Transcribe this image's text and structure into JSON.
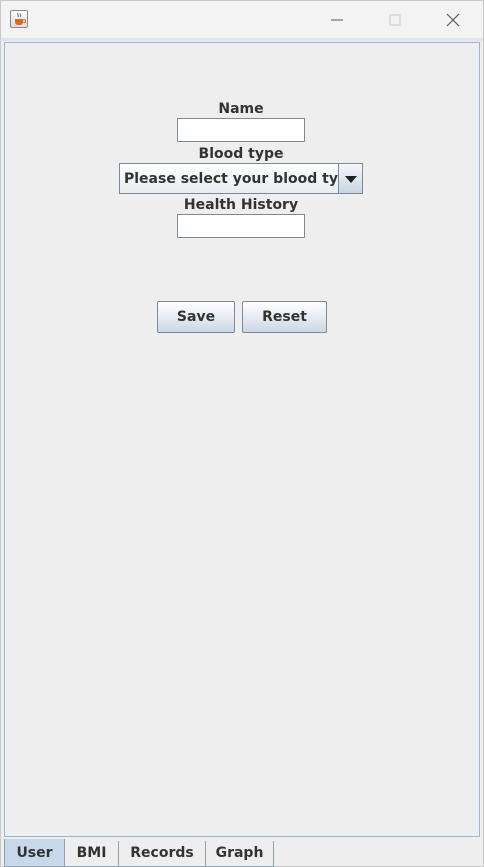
{
  "window": {
    "icon": "java-cup-icon",
    "controls": [
      "minimize-icon",
      "maximize-icon",
      "close-icon"
    ]
  },
  "form": {
    "name_label": "Name",
    "name_value": "",
    "blood_type_label": "Blood type",
    "blood_type_selected": "Please select your blood type",
    "health_history_label": "Health History",
    "health_history_value": ""
  },
  "buttons": {
    "save": "Save",
    "reset": "Reset"
  },
  "tabs": [
    {
      "label": "User",
      "active": true
    },
    {
      "label": "BMI",
      "active": false
    },
    {
      "label": "Records",
      "active": false
    },
    {
      "label": "Graph",
      "active": false
    }
  ],
  "colors": {
    "active_tab": "#c6d8ea",
    "content_border": "#9db6cf",
    "background": "#eeeeee"
  }
}
